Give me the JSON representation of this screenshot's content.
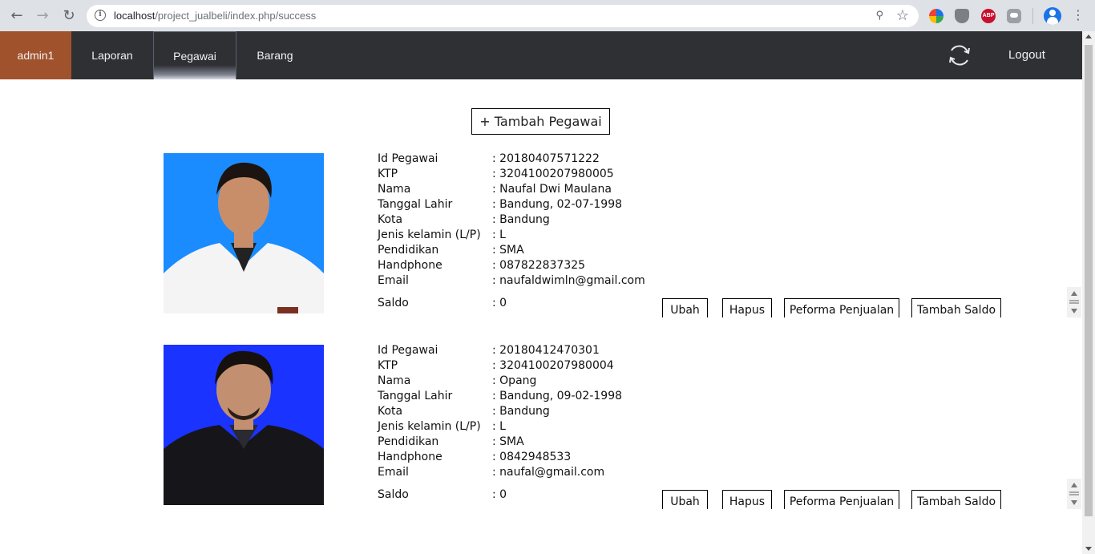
{
  "browser": {
    "url_host": "localhost",
    "url_path": "/project_jualbeli/index.php/success"
  },
  "nav": {
    "admin": "admin1",
    "laporan": "Laporan",
    "pegawai": "Pegawai",
    "barang": "Barang",
    "logout": "Logout"
  },
  "colors": {
    "admin_bg": "#a0522d",
    "nav_bg": "#2f3034",
    "photo_bg_1": "#1a8cff",
    "photo_bg_2": "#1a33ff"
  },
  "add_button": "+ Tambah Pegawai",
  "labels": {
    "id": "Id Pegawai",
    "ktp": "KTP",
    "nama": "Nama",
    "ttl": "Tanggal Lahir",
    "kota": "Kota",
    "jk": "Jenis kelamin (L/P)",
    "pendidikan": "Pendidikan",
    "hp": "Handphone",
    "email": "Email",
    "saldo": "Saldo"
  },
  "actions": {
    "ubah": "Ubah",
    "hapus": "Hapus",
    "peforma": "Peforma Penjualan",
    "saldo": "Tambah Saldo"
  },
  "employees": [
    {
      "id": ": 20180407571222",
      "ktp": ": 3204100207980005",
      "nama": ": Naufal Dwi Maulana",
      "ttl": ": Bandung, 02-07-1998",
      "kota": ": Bandung",
      "jk": ": L",
      "pendidikan": ": SMA",
      "hp": ": 087822837325",
      "email": ": naufaldwimln@gmail.com",
      "saldo": ": 0"
    },
    {
      "id": ": 20180412470301",
      "ktp": ": 3204100207980004",
      "nama": ": Opang",
      "ttl": ": Bandung, 09-02-1998",
      "kota": ": Bandung",
      "jk": ": L",
      "pendidikan": ": SMA",
      "hp": ": 0842948533",
      "email": ": naufal@gmail.com",
      "saldo": ": 0"
    }
  ]
}
